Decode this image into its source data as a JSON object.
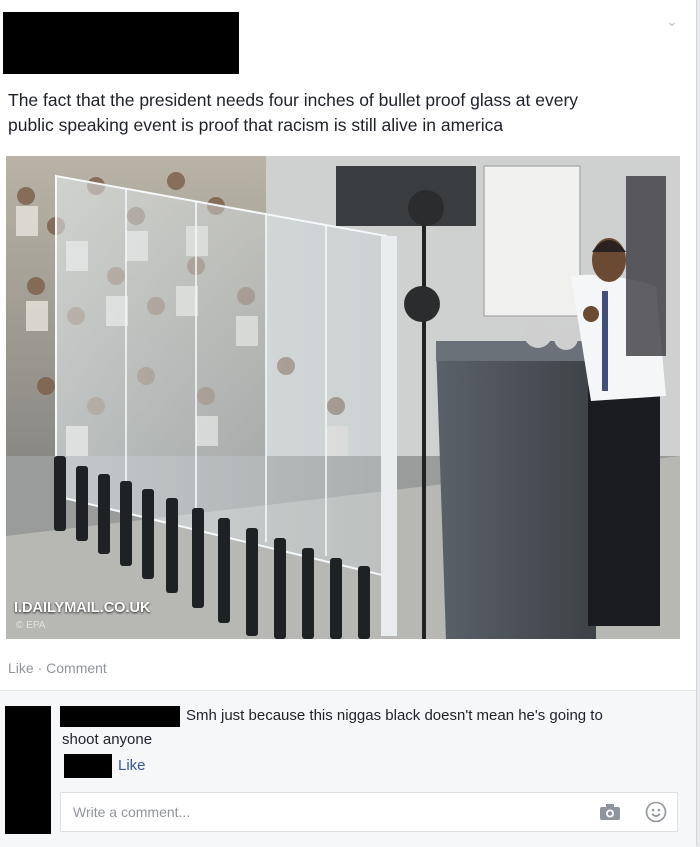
{
  "post": {
    "text_line1": "The fact that the president needs four inches of bullet proof glass at every",
    "text_line2": "public speaking event is proof that racism is still alive in america",
    "link_source": "I.DAILYMAIL.CO.UK",
    "photo_credit": "© EPA",
    "actions": {
      "like": "Like",
      "separator": " · ",
      "comment": "Comment"
    }
  },
  "comment": {
    "text_line1": "Smh just because this niggas black doesn't mean he's going to",
    "text_line2": "shoot anyone",
    "like_label": "Like"
  },
  "composer": {
    "placeholder": "Write a comment..."
  },
  "icons": {
    "menu": "chevron-down-icon",
    "share": "share-arrow-icon",
    "camera": "camera-icon",
    "emoji": "smiley-icon"
  },
  "colors": {
    "link_blue": "#365899",
    "meta_gray": "#90949c",
    "text": "#1d2129"
  }
}
